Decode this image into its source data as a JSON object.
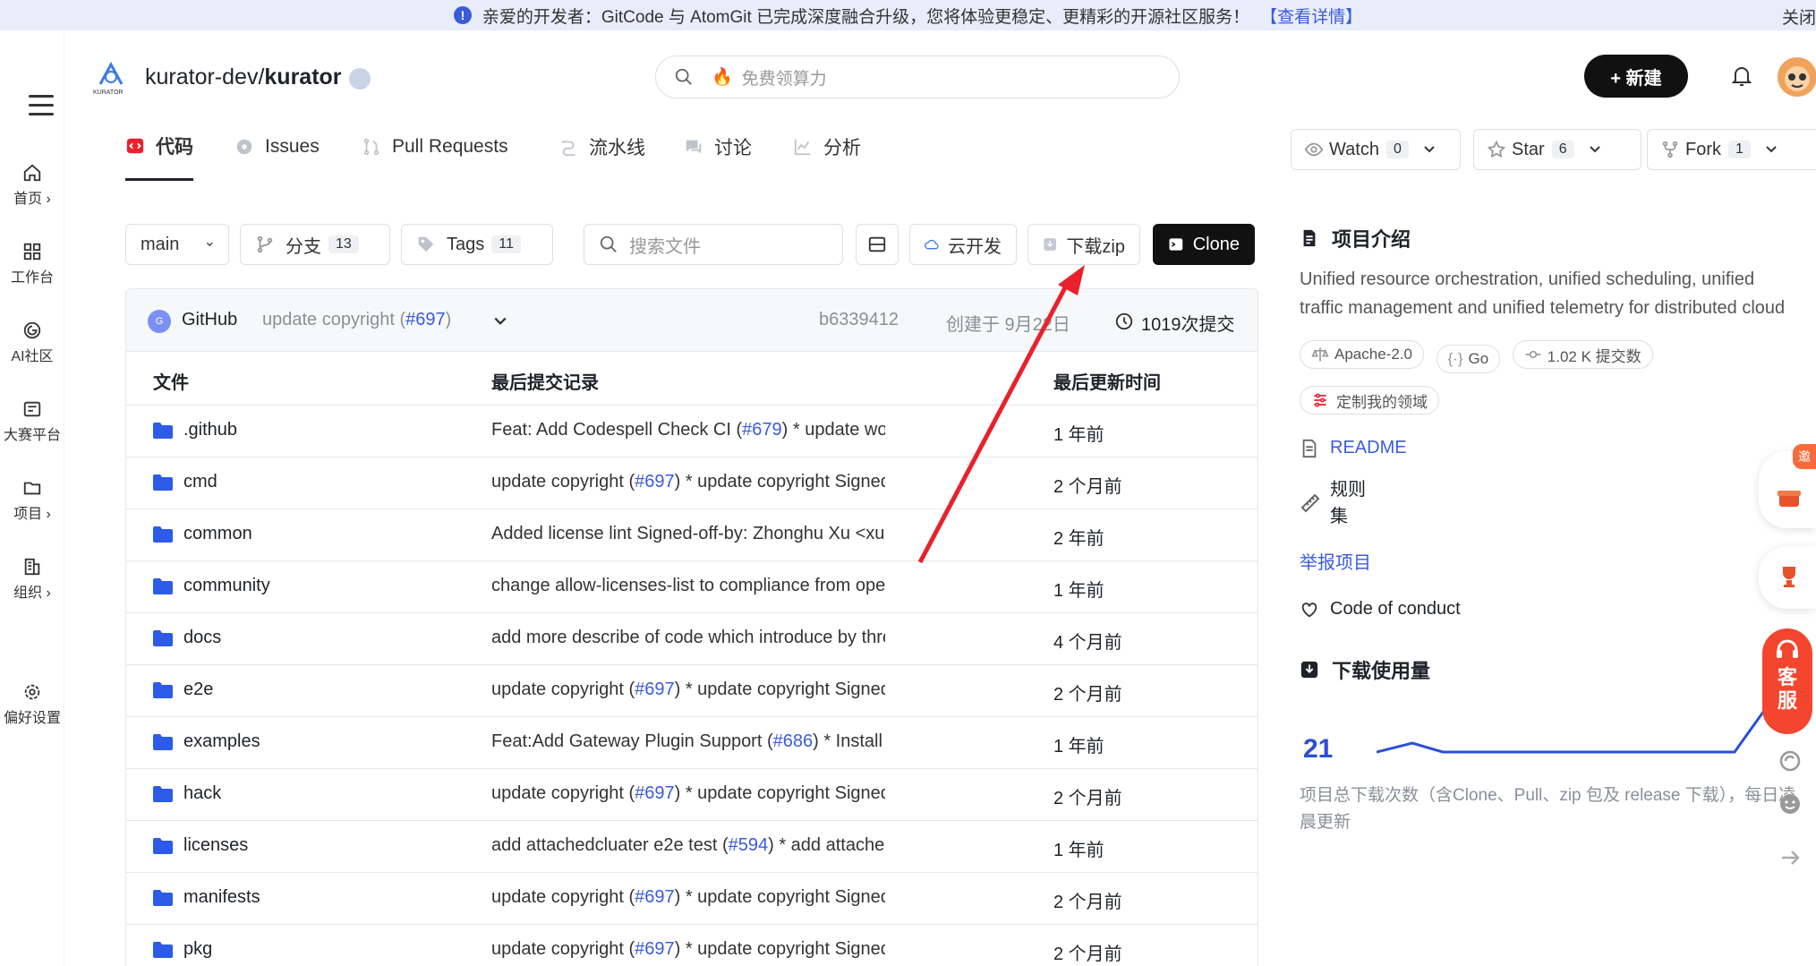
{
  "banner": {
    "text": "亲爱的开发者：GitCode 与 AtomGit 已完成深度融合升级，您将体验更稳定、更精彩的开源社区服务！",
    "link": "【查看详情】",
    "close": "关闭"
  },
  "leftnav": {
    "items": [
      {
        "label": "首页 ›",
        "icon": "home-icon"
      },
      {
        "label": "工作台",
        "icon": "grid-icon"
      },
      {
        "label": "AI社区",
        "icon": "ai-icon"
      },
      {
        "label": "大赛平台",
        "icon": "contest-icon"
      },
      {
        "label": "项目 ›",
        "icon": "folder-icon"
      },
      {
        "label": "组织 ›",
        "icon": "org-icon"
      },
      {
        "label": "偏好设置",
        "icon": "gear-icon"
      }
    ]
  },
  "header": {
    "owner": "kurator-dev/",
    "repo": "kurator",
    "logo_text": "KURATOR",
    "search_placeholder": "免费领算力",
    "new_button": "+ 新建"
  },
  "tabs": [
    {
      "label": "代码",
      "active": true
    },
    {
      "label": "Issues",
      "active": false
    },
    {
      "label": "Pull Requests",
      "active": false
    },
    {
      "label": "流水线",
      "active": false
    },
    {
      "label": "讨论",
      "active": false
    },
    {
      "label": "分析",
      "active": false
    }
  ],
  "repo_actions": {
    "watch": {
      "label": "Watch",
      "count": "0"
    },
    "star": {
      "label": "Star",
      "count": "6"
    },
    "fork": {
      "label": "Fork",
      "count": "1"
    }
  },
  "toolbar": {
    "branch": "main",
    "branches_label": "分支",
    "branches_count": "13",
    "tags_label": "Tags",
    "tags_count": "11",
    "search_placeholder": "搜索文件",
    "cloud_dev": "云开发",
    "download_zip": "下载zip",
    "clone": "Clone"
  },
  "commit": {
    "avatar_letter": "G",
    "author": "GitHub",
    "message": "update copyright (",
    "pr": "#697",
    "message_end": ")",
    "hash": "b6339412",
    "created": "创建于 9月22日",
    "commits": "1019次提交"
  },
  "table": {
    "headers": {
      "file": "文件",
      "last_commit": "最后提交记录",
      "updated": "最后更新时间"
    },
    "rows": [
      {
        "name": ".github",
        "pre": "Feat: Add Codespell Check CI (",
        "pr": "#679",
        "post": ") * update workflows Si…",
        "time": "1 年前"
      },
      {
        "name": "cmd",
        "pre": "update copyright (",
        "pr": "#697",
        "post": ") * update copyright Signed-off-by: …",
        "time": "2 个月前"
      },
      {
        "name": "common",
        "pre": "Added license lint Signed-off-by: Zhonghu Xu <xuzhonghu…",
        "pr": "",
        "post": "",
        "time": "2 年前"
      },
      {
        "name": "community",
        "pre": "change allow-licenses-list to compliance from open-sourc…",
        "pr": "",
        "post": "",
        "time": "1 年前"
      },
      {
        "name": "docs",
        "pre": "add more describe of code which introduce by three party …",
        "pr": "",
        "post": "",
        "time": "4 个月前"
      },
      {
        "name": "e2e",
        "pre": "update copyright (",
        "pr": "#697",
        "post": ") * update copyright Signed-off-by: …",
        "time": "2 个月前"
      },
      {
        "name": "examples",
        "pre": "Feat:Add Gateway Plugin Support (",
        "pr": "#686",
        "post": ") * Install the Gate…",
        "time": "1 年前"
      },
      {
        "name": "hack",
        "pre": "update copyright (",
        "pr": "#697",
        "post": ") * update copyright Signed-off-by: …",
        "time": "2 个月前"
      },
      {
        "name": "licenses",
        "pre": "add attachedcluater e2e test (",
        "pr": "#594",
        "post": ") * add attachedcluater …",
        "time": "1 年前"
      },
      {
        "name": "manifests",
        "pre": "update copyright (",
        "pr": "#697",
        "post": ") * update copyright Signed-off-by: …",
        "time": "2 个月前"
      },
      {
        "name": "pkg",
        "pre": "update copyright (",
        "pr": "#697",
        "post": ") * update copyright Signed-off-by: …",
        "time": "2 个月前"
      }
    ]
  },
  "sidebar": {
    "intro_title": "项目介绍",
    "description": "Unified resource orchestration, unified scheduling, unified traffic management and unified telemetry for distributed cloud",
    "license": "Apache-2.0",
    "language": "Go",
    "commits_chip": "1.02 K 提交数",
    "customize": "定制我的领域",
    "readme": "README",
    "rules": "规则\n集",
    "report": "举报项目",
    "conduct": "Code of conduct",
    "downloads_title": "下载使用量",
    "downloads_count": "21",
    "downloads_note": "项目总下载次数（含Clone、Pull、zip 包及 release 下载），每日凌晨更新"
  },
  "floating": {
    "invite": "邀",
    "service": "客\n服"
  },
  "colors": {
    "accent": "#3b5bdb",
    "banner_bg": "#e8ecfb",
    "arrow": "#e8212b",
    "black_btn": "#111111"
  }
}
